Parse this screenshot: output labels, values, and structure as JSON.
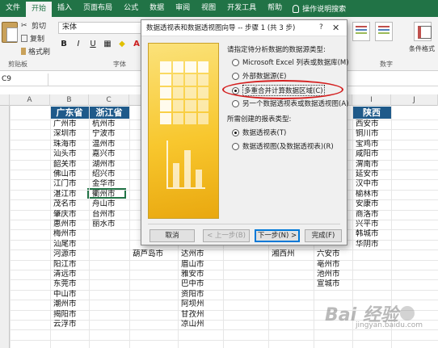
{
  "ribbon": {
    "tabs": [
      "文件",
      "开始",
      "插入",
      "页面布局",
      "公式",
      "数据",
      "审阅",
      "视图",
      "开发工具",
      "帮助"
    ],
    "active_tab": "开始",
    "tell_me": "操作说明搜索",
    "cut": "剪切",
    "copy": "复制",
    "format_painter": "格式刷",
    "clipboard_group": "剪贴板",
    "font_name": "宋体",
    "font_group": "字体",
    "number_group": "数字",
    "conditional_format": "条件格式"
  },
  "formula_bar": {
    "name_box": "C9"
  },
  "columns": [
    "A",
    "B",
    "C",
    "D",
    "E",
    "F",
    "G",
    "H",
    "I",
    "J"
  ],
  "sheet": {
    "headers": {
      "B": "广东省",
      "C": "浙江省",
      "I": "陕西"
    },
    "col_b": [
      "广州市",
      "深圳市",
      "珠海市",
      "汕头市",
      "韶关市",
      "佛山市",
      "江门市",
      "湛江市",
      "茂名市",
      "肇庆市",
      "惠州市",
      "梅州市",
      "汕尾市",
      "河源市",
      "阳江市",
      "清远市",
      "东莞市",
      "中山市",
      "潮州市",
      "揭阳市",
      "云浮市"
    ],
    "col_c": [
      "杭州市",
      "宁波市",
      "温州市",
      "嘉兴市",
      "湖州市",
      "绍兴市",
      "金华市",
      "衢州市",
      "舟山市",
      "台州市",
      "丽水市"
    ],
    "col_i": [
      "西安市",
      "铜川市",
      "宝鸡市",
      "咸阳市",
      "渭南市",
      "延安市",
      "汉中市",
      "榆林市",
      "安康市",
      "商洛市",
      "兴平市",
      "韩城市",
      "华阴市"
    ],
    "col_d_partial": "葫芦岛市",
    "col_e": [
      "达州市",
      "眉山市",
      "雅安市",
      "巴中市",
      "资阳市",
      "阿坝州",
      "甘孜州",
      "凉山州"
    ],
    "col_g_partial": "湘西州",
    "col_h": [
      "六安市",
      "亳州市",
      "池州市",
      "宣城市"
    ]
  },
  "dialog": {
    "title": "数据透视表和数据透视图向导 -- 步骤 1 (共 3 步)",
    "help": "?",
    "close": "✕",
    "section1": "请指定待分析数据的数据源类型:",
    "options1": [
      "Microsoft Excel 列表或数据库(M)",
      "外部数据源(E)",
      "多重合并计算数据区域(C)",
      "另一个数据透视表或数据透视图(A)"
    ],
    "selected1": 2,
    "section2": "所需创建的报表类型:",
    "options2": [
      "数据透视表(T)",
      "数据透视图(及数据透视表)(R)"
    ],
    "selected2": 0,
    "buttons": {
      "cancel": "取消",
      "back": "< 上一步(B)",
      "next": "下一步(N) >",
      "finish": "完成(F)"
    }
  },
  "watermark": {
    "brand": "Bai  经验",
    "sub": "jingyan.baidu.com"
  }
}
